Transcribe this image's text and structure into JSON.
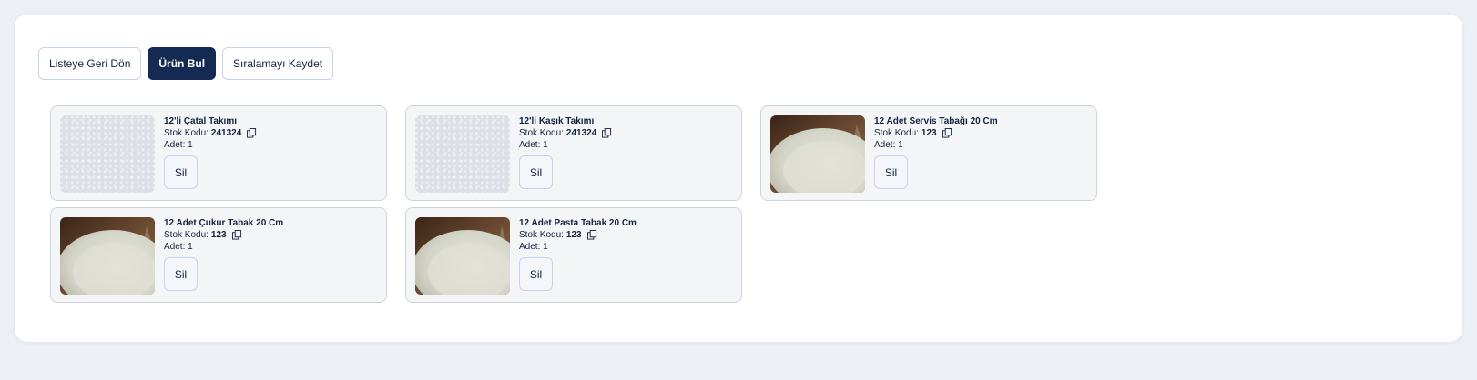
{
  "toolbar": {
    "back_label": "Listeye Geri Dön",
    "find_label": "Ürün Bul",
    "save_order_label": "Sıralamayı Kaydet"
  },
  "product_labels": {
    "stock_code": "Stok Kodu:",
    "quantity": "Adet: 1",
    "delete": "Sil"
  },
  "products": [
    {
      "name": "12'li Çatal Takımı",
      "stock_code": "241324",
      "quantity": "1",
      "image": "blank"
    },
    {
      "name": "12'li Kaşık Takımı",
      "stock_code": "241324",
      "quantity": "1",
      "image": "blank"
    },
    {
      "name": "12 Adet Servis Tabağı 20 Cm",
      "stock_code": "123",
      "quantity": "1",
      "image": "plate"
    },
    {
      "name": "12 Adet Çukur Tabak 20 Cm",
      "stock_code": "123",
      "quantity": "1",
      "image": "plate"
    },
    {
      "name": "12 Adet Pasta Tabak 20 Cm",
      "stock_code": "123",
      "quantity": "1",
      "image": "plate"
    }
  ],
  "icons": {
    "copy": "copy-icon"
  }
}
